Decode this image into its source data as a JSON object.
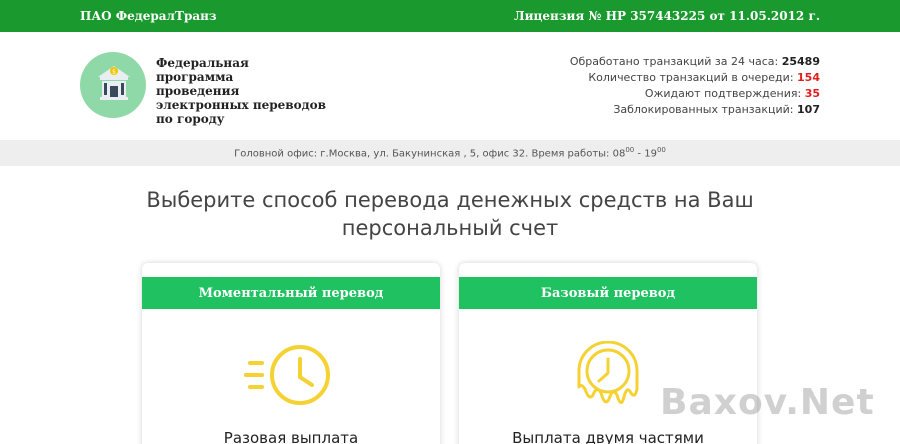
{
  "topbar": {
    "company": "ПАО ФедералТранз",
    "license": "Лицензия № НР 357443225 от 11.05.2012 г."
  },
  "header": {
    "brand_lines": [
      "Федеральная программа",
      "проведения",
      "электронных переводов",
      "по городу"
    ]
  },
  "stats": [
    {
      "label": "Обработано транзакций за 24 часа:",
      "value": "25489",
      "red": false
    },
    {
      "label": "Количество транзакций в очереди:",
      "value": "154",
      "red": true
    },
    {
      "label": "Ожидают подтверждения:",
      "value": "35",
      "red": true
    },
    {
      "label": "Заблокированных транзакций:",
      "value": "107",
      "red": false
    }
  ],
  "office": {
    "text": "Головной офис: г.Москва, ул. Бакунинская , 5, офис 32. Время работы: 08",
    "open_sup": "00",
    "dash": " - 19",
    "close_sup": "00"
  },
  "main": {
    "title": "Выберите способ перевода денежных средств на Ваш персональный счет"
  },
  "cards": [
    {
      "title": "Моментальный перевод",
      "subtitle": "Разовая выплата"
    },
    {
      "title": "Базовый перевод",
      "subtitle": "Выплата двумя частями"
    }
  ],
  "watermark": "Baxov.Net",
  "colors": {
    "topbar": "#1a9a2e",
    "card_head": "#1fc160",
    "icon_yellow": "#f5d132",
    "stat_red": "#e02020",
    "logo_bg": "#8fd9a8"
  }
}
